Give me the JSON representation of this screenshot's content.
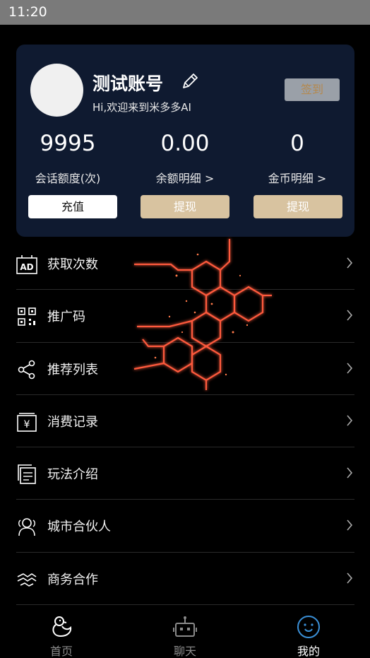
{
  "status_bar": {
    "time": "11:20"
  },
  "profile": {
    "username": "测试账号",
    "welcome": "Hi,欢迎来到米多多AI",
    "checkin_label": "签到"
  },
  "stats": [
    {
      "value": "9995",
      "label": "会话额度(次)",
      "button": "充值"
    },
    {
      "value": "0.00",
      "label": "余额明细 >",
      "button": "提现"
    },
    {
      "value": "0",
      "label": "金币明细 >",
      "button": "提现"
    }
  ],
  "menu": [
    {
      "label": "获取次数",
      "icon": "ad-icon"
    },
    {
      "label": "推广码",
      "icon": "qr-code-icon"
    },
    {
      "label": "推荐列表",
      "icon": "share-icon"
    },
    {
      "label": "消费记录",
      "icon": "receipt-icon"
    },
    {
      "label": "玩法介绍",
      "icon": "document-icon"
    },
    {
      "label": "城市合伙人",
      "icon": "people-icon"
    },
    {
      "label": "商务合作",
      "icon": "handshake-icon"
    }
  ],
  "tabs": [
    {
      "label": "首页",
      "icon": "duck-icon",
      "active": false
    },
    {
      "label": "聊天",
      "icon": "robot-icon",
      "active": false
    },
    {
      "label": "我的",
      "icon": "profile-icon",
      "active": true
    }
  ],
  "colors": {
    "card_bg": "#0f1a30",
    "tan_button": "#d8c3a0",
    "checkin_bg": "#9aa0a8",
    "accent_blue": "#3a8fd6"
  }
}
